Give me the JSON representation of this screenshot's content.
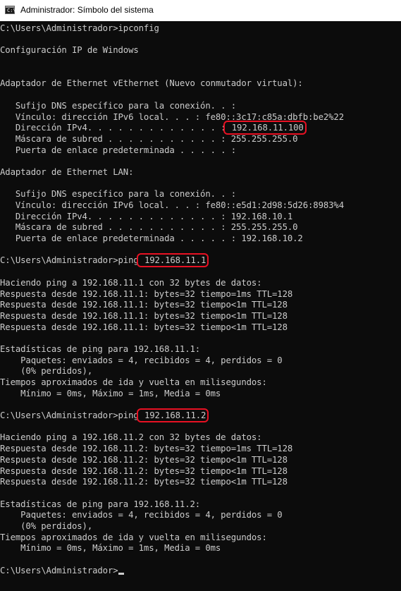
{
  "window": {
    "title": "Administrador: Símbolo del sistema"
  },
  "lines": [
    {
      "pre": "C:\\Users\\Administrador>ipconfig",
      "mark": "",
      "post": ""
    },
    {
      "pre": "",
      "mark": "",
      "post": ""
    },
    {
      "pre": "Configuración IP de Windows",
      "mark": "",
      "post": ""
    },
    {
      "pre": "",
      "mark": "",
      "post": ""
    },
    {
      "pre": "",
      "mark": "",
      "post": ""
    },
    {
      "pre": "Adaptador de Ethernet vEthernet (Nuevo conmutador virtual):",
      "mark": "",
      "post": ""
    },
    {
      "pre": "",
      "mark": "",
      "post": ""
    },
    {
      "pre": "   Sufijo DNS específico para la conexión. . :",
      "mark": "",
      "post": ""
    },
    {
      "pre": "   Vínculo: dirección IPv6 local. . . : fe80::3c17:c85a:dbfb:be2%22",
      "mark": "",
      "post": ""
    },
    {
      "pre": "   Dirección IPv4. . . . . . . . . . . . . :",
      "mark": " 192.168.11.100",
      "post": ""
    },
    {
      "pre": "   Máscara de subred . . . . . . . . . . . : 255.255.255.0",
      "mark": "",
      "post": ""
    },
    {
      "pre": "   Puerta de enlace predeterminada . . . . . :",
      "mark": "",
      "post": ""
    },
    {
      "pre": "",
      "mark": "",
      "post": ""
    },
    {
      "pre": "Adaptador de Ethernet LAN:",
      "mark": "",
      "post": ""
    },
    {
      "pre": "",
      "mark": "",
      "post": ""
    },
    {
      "pre": "   Sufijo DNS específico para la conexión. . :",
      "mark": "",
      "post": ""
    },
    {
      "pre": "   Vínculo: dirección IPv6 local. . . : fe80::e5d1:2d98:5d26:8983%4",
      "mark": "",
      "post": ""
    },
    {
      "pre": "   Dirección IPv4. . . . . . . . . . . . . : 192.168.10.1",
      "mark": "",
      "post": ""
    },
    {
      "pre": "   Máscara de subred . . . . . . . . . . . : 255.255.255.0",
      "mark": "",
      "post": ""
    },
    {
      "pre": "   Puerta de enlace predeterminada . . . . . : 192.168.10.2",
      "mark": "",
      "post": ""
    },
    {
      "pre": "",
      "mark": "",
      "post": ""
    },
    {
      "pre": "C:\\Users\\Administrador>ping",
      "mark": " 192.168.11.1",
      "post": ""
    },
    {
      "pre": "",
      "mark": "",
      "post": ""
    },
    {
      "pre": "Haciendo ping a 192.168.11.1 con 32 bytes de datos:",
      "mark": "",
      "post": ""
    },
    {
      "pre": "Respuesta desde 192.168.11.1: bytes=32 tiempo=1ms TTL=128",
      "mark": "",
      "post": ""
    },
    {
      "pre": "Respuesta desde 192.168.11.1: bytes=32 tiempo<1m TTL=128",
      "mark": "",
      "post": ""
    },
    {
      "pre": "Respuesta desde 192.168.11.1: bytes=32 tiempo<1m TTL=128",
      "mark": "",
      "post": ""
    },
    {
      "pre": "Respuesta desde 192.168.11.1: bytes=32 tiempo<1m TTL=128",
      "mark": "",
      "post": ""
    },
    {
      "pre": "",
      "mark": "",
      "post": ""
    },
    {
      "pre": "Estadísticas de ping para 192.168.11.1:",
      "mark": "",
      "post": ""
    },
    {
      "pre": "    Paquetes: enviados = 4, recibidos = 4, perdidos = 0",
      "mark": "",
      "post": ""
    },
    {
      "pre": "    (0% perdidos),",
      "mark": "",
      "post": ""
    },
    {
      "pre": "Tiempos aproximados de ida y vuelta en milisegundos:",
      "mark": "",
      "post": ""
    },
    {
      "pre": "    Mínimo = 0ms, Máximo = 1ms, Media = 0ms",
      "mark": "",
      "post": ""
    },
    {
      "pre": "",
      "mark": "",
      "post": ""
    },
    {
      "pre": "C:\\Users\\Administrador>ping",
      "mark": " 192.168.11.2",
      "post": ""
    },
    {
      "pre": "",
      "mark": "",
      "post": ""
    },
    {
      "pre": "Haciendo ping a 192.168.11.2 con 32 bytes de datos:",
      "mark": "",
      "post": ""
    },
    {
      "pre": "Respuesta desde 192.168.11.2: bytes=32 tiempo=1ms TTL=128",
      "mark": "",
      "post": ""
    },
    {
      "pre": "Respuesta desde 192.168.11.2: bytes=32 tiempo<1m TTL=128",
      "mark": "",
      "post": ""
    },
    {
      "pre": "Respuesta desde 192.168.11.2: bytes=32 tiempo<1m TTL=128",
      "mark": "",
      "post": ""
    },
    {
      "pre": "Respuesta desde 192.168.11.2: bytes=32 tiempo<1m TTL=128",
      "mark": "",
      "post": ""
    },
    {
      "pre": "",
      "mark": "",
      "post": ""
    },
    {
      "pre": "Estadísticas de ping para 192.168.11.2:",
      "mark": "",
      "post": ""
    },
    {
      "pre": "    Paquetes: enviados = 4, recibidos = 4, perdidos = 0",
      "mark": "",
      "post": ""
    },
    {
      "pre": "    (0% perdidos),",
      "mark": "",
      "post": ""
    },
    {
      "pre": "Tiempos aproximados de ida y vuelta en milisegundos:",
      "mark": "",
      "post": ""
    },
    {
      "pre": "    Mínimo = 0ms, Máximo = 1ms, Media = 0ms",
      "mark": "",
      "post": ""
    },
    {
      "pre": "",
      "mark": "",
      "post": ""
    },
    {
      "pre": "C:\\Users\\Administrador>",
      "mark": "",
      "post": "",
      "cursor": true
    }
  ],
  "icons": {
    "app": "terminal-icon",
    "app_glyph": "C:\\"
  },
  "colors": {
    "console_bg": "#0c0c0c",
    "console_text": "#cccccc",
    "highlight_box": "#e81123",
    "titlebar_bg": "#ffffff"
  }
}
